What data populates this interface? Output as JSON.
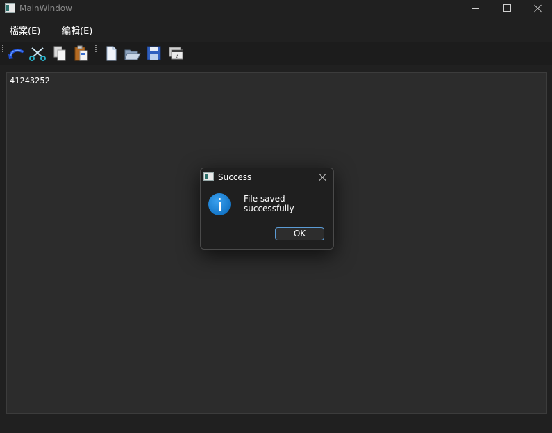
{
  "window": {
    "title": "MainWindow",
    "controls": {
      "minimize_icon": "minimize-icon",
      "maximize_icon": "maximize-icon",
      "close_icon": "close-icon"
    }
  },
  "menubar": {
    "items": [
      {
        "label": "檔案(E)"
      },
      {
        "label": "編輯(E)"
      }
    ]
  },
  "toolbar": {
    "groups": [
      [
        "undo-icon",
        "cut-icon",
        "copy-icon",
        "paste-icon"
      ],
      [
        "new-file-icon",
        "open-folder-icon",
        "save-icon",
        "help-icon"
      ]
    ]
  },
  "editor": {
    "content": "41243252"
  },
  "dialog": {
    "title": "Success",
    "message": "File saved successfully",
    "icon": "info-icon",
    "ok_label": "OK",
    "accent": "#5b9bd5"
  },
  "colors": {
    "background": "#202020",
    "editor_bg": "#2c2c2c",
    "info_blue": "#1577c9"
  }
}
